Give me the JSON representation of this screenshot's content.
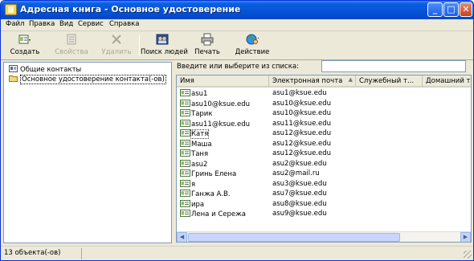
{
  "window": {
    "title": "Адресная книга - Основное удостоверение",
    "minimize": "_",
    "maximize": "□",
    "close": "✕"
  },
  "menu": [
    "Файл",
    "Правка",
    "Вид",
    "Сервис",
    "Справка"
  ],
  "toolbar": {
    "create": "Создать",
    "properties": "Свойства",
    "delete": "Удалить",
    "find": "Поиск людей",
    "print": "Печать",
    "action": "Действие"
  },
  "tree": {
    "shared": "Общие контакты",
    "main": "Основное удостоверение контакта(-ов)"
  },
  "search": {
    "label": "Введите или выберите из списка:",
    "value": ""
  },
  "columns": {
    "name": "Имя",
    "email": "Электронная почта",
    "work": "Служебный т...",
    "home": "Домашний телефо"
  },
  "rows": [
    {
      "name": "asu1",
      "email": "asu1@ksue.edu"
    },
    {
      "name": "asu10@ksue.edu",
      "email": "asu10@ksue.edu"
    },
    {
      "name": "Тарик",
      "email": "asu10@ksue.edu"
    },
    {
      "name": "asu11@ksue.edu",
      "email": "asu11@ksue.edu"
    },
    {
      "name": "Катя",
      "email": "asu12@ksue.edu"
    },
    {
      "name": "Маша",
      "email": "asu12@ksue.edu"
    },
    {
      "name": "Таня",
      "email": "asu12@ksue.edu"
    },
    {
      "name": "asu2",
      "email": "asu2@ksue.edu"
    },
    {
      "name": "Гринь Елена",
      "email": "asu2@mail.ru"
    },
    {
      "name": "я",
      "email": "asu3@ksue.edu"
    },
    {
      "name": "Ганжа А.В.",
      "email": "asu7@ksue.edu"
    },
    {
      "name": "ира",
      "email": "asu8@ksue.edu"
    },
    {
      "name": "Лена и Сережа",
      "email": "asu9@ksue.edu"
    }
  ],
  "status": "13 объекта(-ов)",
  "colors": {
    "titlebar": "#0553d4",
    "window_bg": "#ece9d8",
    "selection_border": "#000000"
  }
}
